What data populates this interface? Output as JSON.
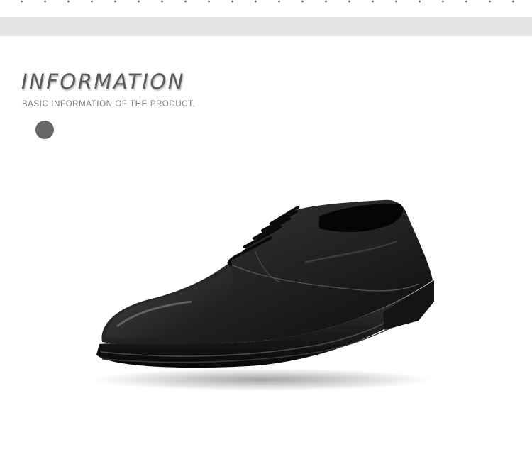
{
  "info": {
    "title": "INFORMATION",
    "subtitle": "BASIC INFORMATION OF THE PRODUCT."
  },
  "color_options": [
    {
      "color": "#666666"
    }
  ],
  "colors": {
    "gray_bar": "#e4e4e4",
    "title_text": "#5a5a5a",
    "subtitle_text": "#7c7c7c",
    "shoe_leather": "#1a1a1a"
  },
  "icons": {
    "product": "black-leather-oxford-shoe"
  }
}
